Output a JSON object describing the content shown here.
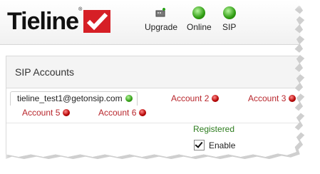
{
  "brand": {
    "name": "Tieline",
    "registered": "®"
  },
  "toolbar": {
    "upgrade_label": "Upgrade",
    "online_label": "Online",
    "sip_label": "SIP"
  },
  "panel": {
    "title": "SIP Accounts"
  },
  "tabs": [
    {
      "label": "tieline_test1@getonsip.com",
      "status": "green",
      "active": true
    },
    {
      "label": "Account 2",
      "status": "red",
      "active": false
    },
    {
      "label": "Account 3",
      "status": "red",
      "active": false
    },
    {
      "label": "Account 5",
      "status": "red",
      "active": false
    },
    {
      "label": "Account 6",
      "status": "red",
      "active": false
    }
  ],
  "account": {
    "status_text": "Registered",
    "enable_label": "Enable",
    "enable_checked": true
  },
  "colors": {
    "status_green": "#2e7d1f",
    "tab_red": "#b8262c",
    "logo_red": "#d61f26"
  }
}
